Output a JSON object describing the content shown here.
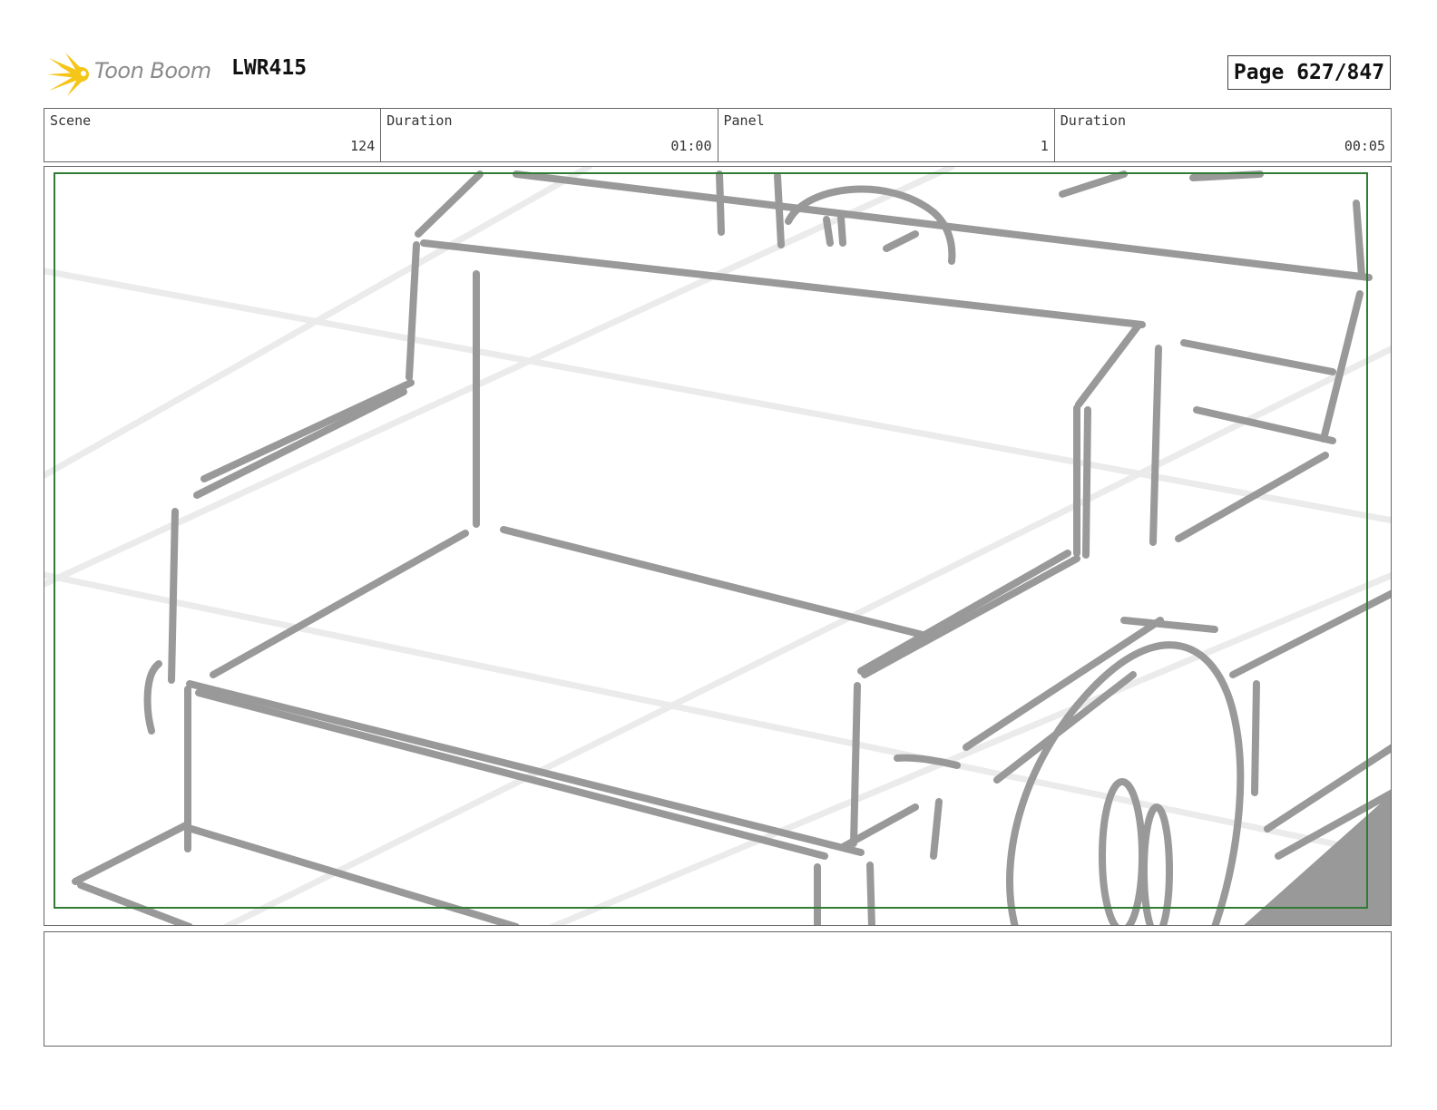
{
  "header": {
    "logo_text": "Toon Boom",
    "project_code": "LWR415",
    "page_label": "Page 627/847"
  },
  "info": [
    {
      "label": "Scene",
      "value": "124"
    },
    {
      "label": "Duration",
      "value": "01:00"
    },
    {
      "label": "Panel",
      "value": "1"
    },
    {
      "label": "Duration",
      "value": "00:05"
    }
  ],
  "colors": {
    "sketch": "#999999",
    "grid": "#ebebeb",
    "safe_frame": "#2e7d32",
    "logo_star": "#f5c518"
  },
  "panel": {
    "drawing": "rough sketch of a car interior bench seat with steering wheel"
  },
  "notes": {
    "text": ""
  }
}
